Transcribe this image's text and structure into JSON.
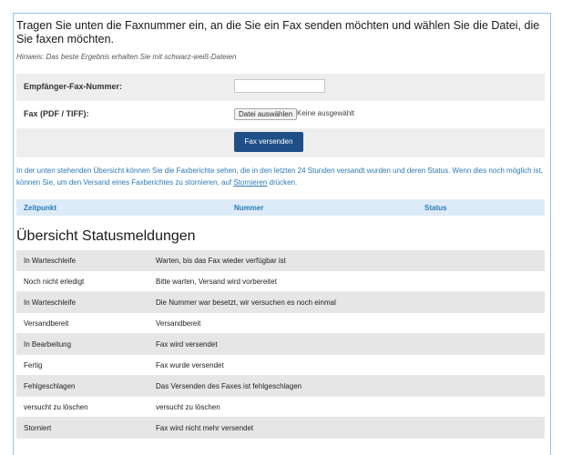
{
  "intro": {
    "text": "Tragen Sie unten die Faxnummer ein, an die Sie ein Fax senden möchten und wählen Sie die Datei, die Sie faxen möchten.",
    "hint": "Hinweis: Das beste Ergebnis erhalten Sie mit schwarz-weiß-Dateien"
  },
  "form": {
    "recipient_label": "Empfänger-Fax-Nummer:",
    "recipient_value": "",
    "file_label": "Fax (PDF / TIFF):",
    "file_button": "Datei auswählen",
    "file_status": "Keine ausgewählt",
    "send_button": "Fax versenden"
  },
  "overview_info": {
    "text": "In der unten stehenden Übersicht können Sie die Faxberichte sehen, die in den letzten 24 Stunden versandt wurden und deren Status. Wenn dies noch möglich ist, können Sie, um den Versand eines Faxberichtes zu stornieren, auf ",
    "link": "Stornieren",
    "text_end": " drücken.",
    "columns": [
      "Zeitpunkt",
      "Nummer",
      "Status"
    ]
  },
  "status_overview": {
    "title": "Übersicht Statusmeldungen",
    "rows": [
      {
        "status": "In Warteschleife",
        "description": "Warten, bis das Fax wieder verfügbar ist"
      },
      {
        "status": "Noch nicht erledigt",
        "description": "Bitte warten, Versand wird vorbereitet"
      },
      {
        "status": "In Warteschleife",
        "description": "Die Nummer war besetzt, wir versuchen es noch einmal"
      },
      {
        "status": "Versandbereit",
        "description": "Versandbereit"
      },
      {
        "status": "In Bearbeitung",
        "description": "Fax wird versendet"
      },
      {
        "status": "Fertig",
        "description": "Fax wurde versendet"
      },
      {
        "status": "Fehlgeschlagen",
        "description": "Das Versenden des Faxes ist fehlgeschlagen"
      },
      {
        "status": "versucht zu löschen",
        "description": "versucht zu löschen"
      },
      {
        "status": "Storniert",
        "description": "Fax wird nicht mehr versendet"
      }
    ]
  },
  "colors": {
    "frame_border": "#8fc4e8",
    "send_button": "#1f4f87",
    "info_text": "#2a7ab8",
    "table_header": "#dcebf7"
  }
}
